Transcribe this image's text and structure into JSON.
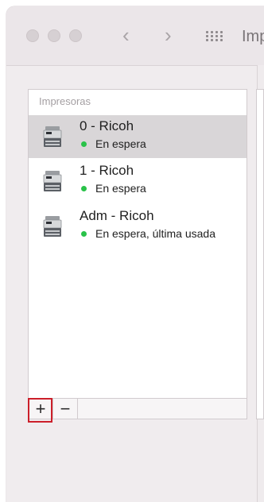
{
  "window": {
    "title": "Imp"
  },
  "nav": {
    "back_symbol": "‹",
    "forward_symbol": "›"
  },
  "printers": {
    "header": "Impresoras",
    "items": [
      {
        "name": "0 - Ricoh",
        "status": "En espera",
        "status_color": "#29c249",
        "selected": true
      },
      {
        "name": "1 - Ricoh",
        "status": "En espera",
        "status_color": "#29c249",
        "selected": false
      },
      {
        "name": "Adm - Ricoh",
        "status": "En espera, última usada",
        "status_color": "#29c249",
        "selected": false
      }
    ]
  },
  "toolbar": {
    "add_label": "+",
    "remove_label": "−"
  },
  "colors": {
    "selection": "#d9d6d8",
    "highlight_border": "#cc1f2a"
  }
}
